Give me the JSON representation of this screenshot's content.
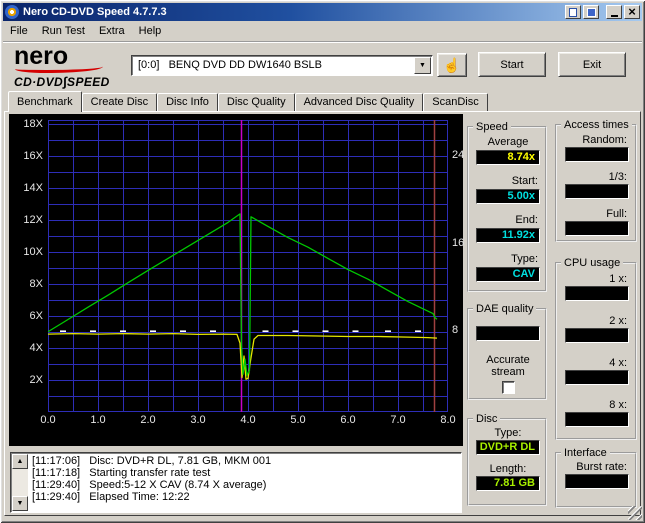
{
  "window": {
    "title": "Nero CD-DVD Speed 4.7.7.3"
  },
  "menu": {
    "items": [
      "File",
      "Run Test",
      "Extra",
      "Help"
    ]
  },
  "logo": {
    "brand": "nero",
    "product1": "CD·DVD",
    "sep": "∫",
    "product2": "SPEED",
    "swoosh_color": "#d40000"
  },
  "toolbar": {
    "drive_selected": "[0:0]   BENQ DVD DD DW1640 BSLB",
    "start_label": "Start",
    "exit_label": "Exit",
    "hand_icon": "pointing-hand"
  },
  "tabs": [
    {
      "label": "Benchmark",
      "selected": true
    },
    {
      "label": "Create Disc",
      "selected": false
    },
    {
      "label": "Disc Info",
      "selected": false
    },
    {
      "label": "Disc Quality",
      "selected": false
    },
    {
      "label": "Advanced Disc Quality",
      "selected": false
    },
    {
      "label": "ScanDisc",
      "selected": false
    }
  ],
  "chart_data": {
    "type": "line",
    "x_unit": "GB",
    "x_range": [
      0,
      8
    ],
    "y_range": [
      0,
      18.25
    ],
    "x_ticks": [
      "0.0",
      "1.0",
      "2.0",
      "3.0",
      "4.0",
      "5.0",
      "6.0",
      "7.0",
      "8.0"
    ],
    "y_left_ticks": [
      "18X",
      "16X",
      "14X",
      "12X",
      "10X",
      "8X",
      "6X",
      "4X",
      "2X"
    ],
    "y_right_ticks": [
      "24",
      "16",
      "8"
    ],
    "background": "#000000",
    "grid": {
      "x_step": 0.5,
      "y_step": 1,
      "color": "#2d2db8"
    },
    "series": [
      {
        "name": "read-speed",
        "color": "#00c800",
        "points": [
          [
            0,
            5.02
          ],
          [
            0.4,
            5.78
          ],
          [
            0.8,
            6.55
          ],
          [
            1.2,
            7.3
          ],
          [
            1.6,
            8.08
          ],
          [
            2.0,
            8.85
          ],
          [
            2.4,
            9.6
          ],
          [
            2.8,
            10.35
          ],
          [
            3.2,
            11.1
          ],
          [
            3.6,
            11.85
          ],
          [
            3.84,
            12.38
          ],
          [
            3.87,
            4.2
          ],
          [
            3.9,
            2.35
          ],
          [
            3.94,
            3.3
          ],
          [
            3.98,
            2.3
          ],
          [
            4.03,
            2.6
          ],
          [
            4.06,
            12.2
          ],
          [
            4.4,
            11.6
          ],
          [
            4.8,
            10.9
          ],
          [
            5.2,
            10.3
          ],
          [
            5.6,
            9.6
          ],
          [
            6.0,
            8.9
          ],
          [
            6.4,
            8.3
          ],
          [
            6.8,
            7.6
          ],
          [
            7.2,
            6.9
          ],
          [
            7.6,
            6.3
          ],
          [
            7.7,
            6.15
          ],
          [
            7.74,
            5.9
          ],
          [
            7.78,
            5.8
          ]
        ]
      },
      {
        "name": "rotation-speed",
        "color": "#e6e600",
        "points": [
          [
            0,
            4.87
          ],
          [
            0.5,
            4.9
          ],
          [
            1.0,
            4.87
          ],
          [
            1.5,
            4.9
          ],
          [
            2.0,
            4.87
          ],
          [
            2.5,
            4.9
          ],
          [
            3.0,
            4.85
          ],
          [
            3.5,
            4.87
          ],
          [
            3.78,
            4.85
          ],
          [
            3.84,
            4.3
          ],
          [
            3.88,
            2.15
          ],
          [
            3.92,
            3.5
          ],
          [
            3.96,
            2.05
          ],
          [
            4.0,
            2.1
          ],
          [
            4.05,
            3.2
          ],
          [
            4.12,
            4.55
          ],
          [
            4.2,
            4.78
          ],
          [
            4.8,
            4.78
          ],
          [
            5.4,
            4.75
          ],
          [
            6.0,
            4.72
          ],
          [
            6.6,
            4.72
          ],
          [
            7.2,
            4.68
          ],
          [
            7.6,
            4.65
          ],
          [
            7.78,
            4.62
          ]
        ]
      }
    ],
    "markers": [
      {
        "name": "layer-break-line",
        "type": "vline",
        "x": 3.87,
        "color": "#c800c8"
      },
      {
        "name": "end-marker-line",
        "type": "vline",
        "x": 7.73,
        "color": "#a04040"
      }
    ],
    "dashes": {
      "name": "calibration-marks",
      "color": "#ffffff",
      "y": 5.05,
      "x_positions": [
        0.3,
        0.9,
        1.5,
        2.1,
        2.7,
        3.3,
        4.35,
        4.95,
        5.55,
        6.15,
        6.8,
        7.4
      ]
    }
  },
  "speed_panel": {
    "title": "Speed",
    "average_label": "Average",
    "average_value": "8.74x",
    "average_color": "#ffff00",
    "start_label": "Start:",
    "start_value": "5.00x",
    "end_label": "End:",
    "end_value": "11.92x",
    "type_label": "Type:",
    "type_value": "CAV",
    "value_color": "#00e0e0"
  },
  "dae_panel": {
    "title": "DAE quality",
    "value": "",
    "accurate_line1": "Accurate",
    "accurate_line2": "stream",
    "checkbox_checked": false
  },
  "disc_panel": {
    "title": "Disc",
    "type_label": "Type:",
    "type_value": "DVD+R DL",
    "length_label": "Length:",
    "length_value": "7.81 GB",
    "value_color": "#a8f000"
  },
  "access_panel": {
    "title": "Access times",
    "random_label": "Random:",
    "random_value": "",
    "third_label": "1/3:",
    "third_value": "",
    "full_label": "Full:",
    "full_value": ""
  },
  "cpu_panel": {
    "title": "CPU usage",
    "rows": [
      {
        "label": "1 x:",
        "value": ""
      },
      {
        "label": "2 x:",
        "value": ""
      },
      {
        "label": "4 x:",
        "value": ""
      },
      {
        "label": "8 x:",
        "value": ""
      }
    ]
  },
  "interface_panel": {
    "title": "Interface",
    "burst_label": "Burst rate:",
    "burst_value": ""
  },
  "log": {
    "lines": [
      "[11:17:06]   Disc: DVD+R DL, 7.81 GB, MKM 001",
      "[11:17:18]   Starting transfer rate test",
      "[11:29:40]   Speed:5-12 X CAV (8.74 X average)",
      "[11:29:40]   Elapsed Time: 12:22"
    ]
  }
}
